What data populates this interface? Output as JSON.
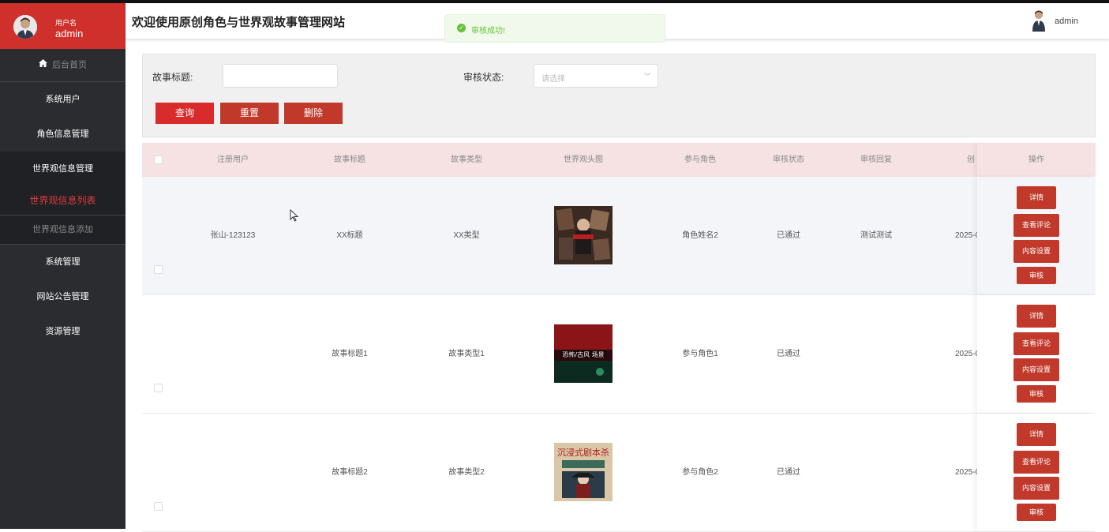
{
  "user": {
    "label": "用户名",
    "name": "admin"
  },
  "header": {
    "title": "欢迎使用原创角色与世界观故事管理网站",
    "admin_name": "admin"
  },
  "toast": {
    "message": "审核成功!"
  },
  "sidebar": {
    "items": [
      {
        "label": "后台首页"
      },
      {
        "label": "系统用户"
      },
      {
        "label": "角色信息管理"
      },
      {
        "label": "世界观信息管理"
      },
      {
        "label": "世界观信息列表"
      },
      {
        "label": "世界观信息添加"
      },
      {
        "label": "系统管理"
      },
      {
        "label": "网站公告管理"
      },
      {
        "label": "资源管理"
      }
    ]
  },
  "search": {
    "title_label": "故事标题:",
    "title_value": "",
    "status_label": "审核状态:",
    "status_placeholder": "请选择",
    "query_btn": "查询",
    "reset_btn": "重置",
    "delete_btn": "删除"
  },
  "table": {
    "headers": [
      "注册用户",
      "故事标题",
      "故事类型",
      "世界观头图",
      "参与角色",
      "审核状态",
      "审核回复",
      "创",
      "操作"
    ],
    "rows": [
      {
        "user": "张山-123123",
        "title": "XX标题",
        "type": "XX类型",
        "role": "角色姓名2",
        "status": "已通过",
        "reply": "测试测试",
        "date": "2025-0"
      },
      {
        "user": "",
        "title": "故事标题1",
        "type": "故事类型1",
        "role": "参与角色1",
        "status": "已通过",
        "reply": "",
        "date": "2025-0"
      },
      {
        "user": "",
        "title": "故事标题2",
        "type": "故事类型2",
        "role": "参与角色2",
        "status": "已通过",
        "reply": "",
        "date": "2025-0"
      }
    ],
    "ops": {
      "detail": "详情",
      "comments": "查看评论",
      "content": "内容设置",
      "audit": "审核"
    }
  },
  "colors": {
    "brand_red": "#d0302c",
    "sidebar_bg": "#2b2c30",
    "active_text": "#e03b3b",
    "success": "#67c23a"
  }
}
